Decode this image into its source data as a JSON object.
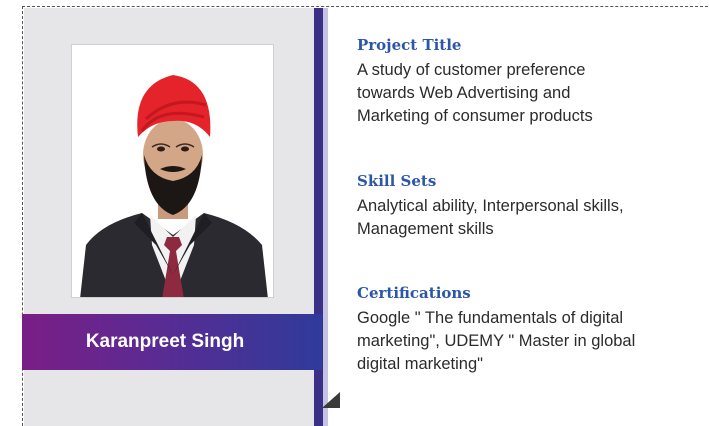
{
  "profile": {
    "name": "Karanpreet Singh"
  },
  "sections": [
    {
      "title": "Project Title",
      "text": "A study of customer preference\ntowards Web Advertising and\nMarketing of consumer products"
    },
    {
      "title": "Skill Sets",
      "text": "Analytical ability, Interpersonal skills,\nManagement skills"
    },
    {
      "title": "Certifications",
      "text": "Google \" The fundamentals of digital\nmarketing\", UDEMY \" Master in global\ndigital marketing\""
    }
  ],
  "colors": {
    "heading": "#2d56a8",
    "accent_bar": "#3b2f88",
    "name_band_start": "#7a1e86",
    "name_band_end": "#2f3b9a",
    "panel": "#e6e6e8"
  }
}
